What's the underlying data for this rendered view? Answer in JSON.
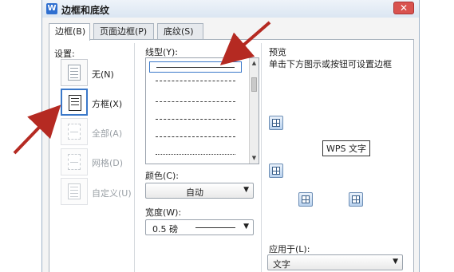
{
  "dialog": {
    "title": "边框和底纹",
    "app_icon_text": "W",
    "close_label": "✕"
  },
  "tabs": [
    {
      "label": "边框(B)",
      "active": true
    },
    {
      "label": "页面边框(P)",
      "active": false
    },
    {
      "label": "底纹(S)",
      "active": false
    }
  ],
  "settings": {
    "label": "设置:",
    "options": [
      {
        "label": "无(N)",
        "selected": false,
        "enabled": true
      },
      {
        "label": "方框(X)",
        "selected": true,
        "enabled": true
      },
      {
        "label": "全部(A)",
        "selected": false,
        "enabled": false
      },
      {
        "label": "网格(D)",
        "selected": false,
        "enabled": false
      },
      {
        "label": "自定义(U)",
        "selected": false,
        "enabled": false
      }
    ]
  },
  "line_style": {
    "label": "线型(Y):",
    "styles": [
      "solid",
      "dashed-long",
      "dashed-short",
      "dash-dot",
      "dash-dot-dot",
      "dotted"
    ]
  },
  "color": {
    "label": "颜色(C):",
    "value": "自动"
  },
  "width": {
    "label": "宽度(W):",
    "value": "0.5  磅"
  },
  "preview": {
    "label": "预览",
    "hint": "单击下方图示或按钮可设置边框",
    "sample_text": "WPS 文字"
  },
  "apply_to": {
    "label": "应用于(L):",
    "value": "文字"
  },
  "colors": {
    "annotation_arrow": "#b52a22",
    "accent": "#3a78c9"
  }
}
